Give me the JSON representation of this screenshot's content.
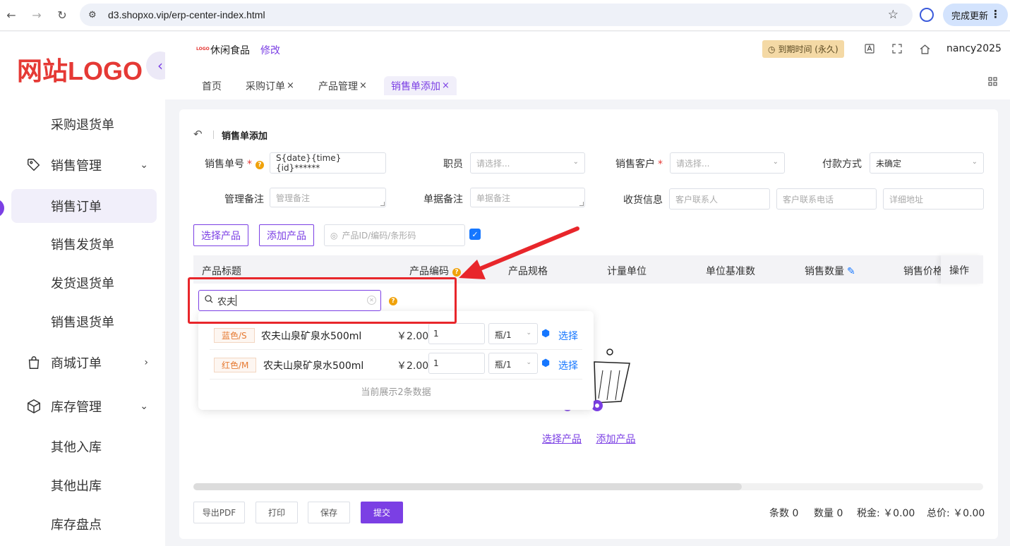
{
  "browser": {
    "url": "d3.shopxo.vip/erp-center-index.html",
    "update_label": "完成更新"
  },
  "sidebar": {
    "logo": "网站LOGO",
    "items": [
      {
        "label": "采购退货单"
      },
      {
        "label": "销售管理"
      },
      {
        "label": "销售订单"
      },
      {
        "label": "销售发货单"
      },
      {
        "label": "发货退货单"
      },
      {
        "label": "销售退货单"
      },
      {
        "label": "商城订单"
      },
      {
        "label": "库存管理"
      },
      {
        "label": "其他入库"
      },
      {
        "label": "其他出库"
      },
      {
        "label": "库存盘点"
      }
    ]
  },
  "header": {
    "shop_logo_text": "LOGO",
    "shop_name": "休闲食品",
    "edit_label": "修改",
    "expire_label": "到期时间 (永久)",
    "username": "nancy2025",
    "tabs": [
      {
        "label": "首页"
      },
      {
        "label": "采购订单"
      },
      {
        "label": "产品管理"
      },
      {
        "label": "销售单添加"
      }
    ],
    "tab_close": "×"
  },
  "form": {
    "title": "销售单添加",
    "order_no_label": "销售单号",
    "order_no_value": "S{date}{time}{id}******",
    "staff_label": "职员",
    "staff_placeholder": "请选择...",
    "customer_label": "销售客户",
    "customer_placeholder": "请选择...",
    "payment_label": "付款方式",
    "payment_value": "未确定",
    "mgmt_note_label": "管理备注",
    "mgmt_note_placeholder": "管理备注",
    "doc_note_label": "单据备注",
    "doc_note_placeholder": "单据备注",
    "shipping_label": "收货信息",
    "contact_placeholder": "客户联系人",
    "phone_placeholder": "客户联系电话",
    "address_placeholder": "详细地址",
    "select_product_btn": "选择产品",
    "add_product_btn": "添加产品",
    "product_search_placeholder": "产品ID/编码/条形码"
  },
  "table": {
    "headers": [
      "产品标题",
      "产品编码",
      "产品规格",
      "计量单位",
      "单位基准数",
      "销售数量",
      "销售价格",
      "操作"
    ]
  },
  "empty": {
    "select_link": "选择产品",
    "add_link": "添加产品"
  },
  "popup": {
    "search_value": "农夫",
    "results": [
      {
        "spec": "蓝色/S",
        "name": "农夫山泉矿泉水500ml",
        "price": "￥2.00",
        "qty": "1",
        "unit": "瓶/1",
        "action": "选择"
      },
      {
        "spec": "红色/M",
        "name": "农夫山泉矿泉水500ml",
        "price": "￥2.00",
        "qty": "1",
        "unit": "瓶/1",
        "action": "选择"
      }
    ],
    "footer": "当前展示2条数据"
  },
  "footer": {
    "export_pdf": "导出PDF",
    "print": "打印",
    "save": "保存",
    "submit": "提交",
    "count_label": "条数 0",
    "qty_label": "数量 0",
    "tax_label": "税金: ￥0.00",
    "total_label": "总价: ￥0.00"
  },
  "colors": {
    "accent": "#7b3fe4",
    "annotation": "#e8262b",
    "link_blue": "#1677ff"
  }
}
